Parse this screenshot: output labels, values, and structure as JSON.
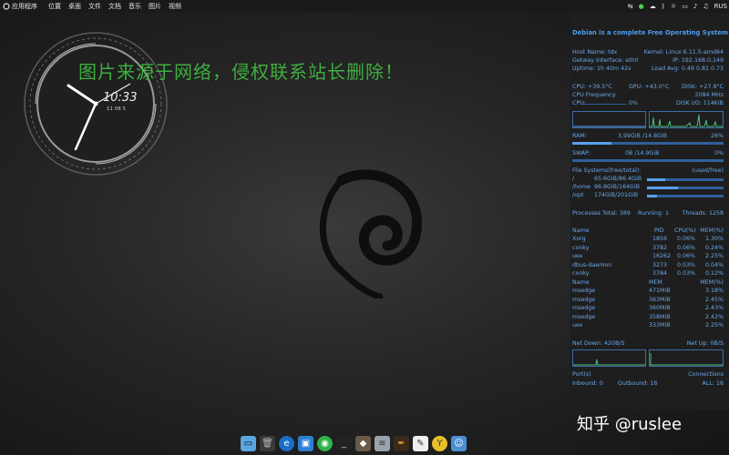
{
  "topbar": {
    "launcher": "应用程序",
    "menu": [
      "位置",
      "桌面",
      "文件",
      "文档",
      "音乐",
      "图片",
      "视频"
    ],
    "keyboard": "RUS"
  },
  "watermark": "图片来源于网络，侵权联系站长删除！",
  "clock": {
    "time": "10:33",
    "date": "11 08 5"
  },
  "conky": {
    "title": "Debian is a complete Free Operating System",
    "host_label": "Host Name:",
    "host": "tdx",
    "kernel_label": "Kernel:",
    "kernel": "Linux 6.11.5-amd64",
    "gateway_label": "Getway Interface:",
    "gateway": "eth0",
    "ip_label": "IP:",
    "ip": "192.168.0.149",
    "uptime_label": "Uptime:",
    "uptime": "1h 40m 42s",
    "load_label": "Load Avg:",
    "load": "0.49 0.81 0.73",
    "cpu_temp_label": "CPU:",
    "cpu_temp": "+39.5°C",
    "gpu_temp_label": "GPU:",
    "gpu_temp": "+43.0°C",
    "disk_temp_label": "DISK:",
    "disk_temp": "+27.9°C",
    "cpu_freq_label": "CPU Frequency:",
    "cpu_freq": "2084 MHz",
    "cpu_label": "CPU:",
    "cpu_pct": "0%",
    "disk_io_label": "DISK I/O:",
    "disk_io": "114KiB",
    "ram_label": "RAM:",
    "ram": "3.99GiB /14.8GiB",
    "ram_pct": "26%",
    "ram_fill": 0.26,
    "swap_label": "SWAP:",
    "swap": "0B /14.9GiB",
    "swap_pct": "0%",
    "swap_fill": 0.0,
    "fs_label": "File Systems(free/total):",
    "fs_used_label": "(used/free)",
    "filesystems": [
      {
        "mount": "/",
        "value": "65.6GiB/86.4GiB",
        "fill": 0.24
      },
      {
        "mount": "/home",
        "value": "96.8GiB/164GiB",
        "fill": 0.41
      },
      {
        "mount": "/opt",
        "value": "174GiB/201GiB",
        "fill": 0.13
      }
    ],
    "proc_total_label": "Processes Total:",
    "proc_total": "389",
    "running_label": "Running:",
    "running": "1",
    "threads_label": "Threads:",
    "threads": "1258",
    "cpu_table_headers": [
      "Name",
      "PID",
      "CPU(%)",
      "MEM(%)"
    ],
    "cpu_table": [
      [
        "Xorg",
        "1856",
        "0.06%",
        "1.30%"
      ],
      [
        "conky",
        "3782",
        "0.06%",
        "0.24%"
      ],
      [
        "uex",
        "16262",
        "0.06%",
        "2.25%"
      ],
      [
        "dbus-daemon",
        "3273",
        "0.03%",
        "0.04%"
      ],
      [
        "conky",
        "3784",
        "0.03%",
        "0.12%"
      ]
    ],
    "mem_table_headers": [
      "Name",
      "MEM",
      "MEM(%)"
    ],
    "mem_table": [
      [
        "msedge",
        "471MiB",
        "3.18%"
      ],
      [
        "msedge",
        "363MiB",
        "2.45%"
      ],
      [
        "msedge",
        "360MiB",
        "2.43%"
      ],
      [
        "msedge",
        "358MiB",
        "2.42%"
      ],
      [
        "uex",
        "333MiB",
        "2.25%"
      ]
    ],
    "net_down_label": "Net Down:",
    "net_down": "420B/S",
    "net_up_label": "Net Up:",
    "net_up": "0B/S",
    "port_label": "Port(s)",
    "connections_label": "Connections",
    "inbound_label": "Inbound:",
    "inbound": "0",
    "outbound_label": "Outbound:",
    "outbound": "16",
    "all_label": "ALL:",
    "all": "16"
  },
  "zhihu": "知乎 @ruslee",
  "dock": {
    "icons": [
      "file-manager-icon",
      "trash-icon",
      "edge-browser-icon",
      "image-viewer-icon",
      "wechat-icon",
      "terminal-icon",
      "gimp-icon",
      "database-icon",
      "feather-icon",
      "text-editor-icon",
      "yozo-office-icon",
      "finder-icon"
    ]
  },
  "colors": {
    "accent": "#4d9cf0",
    "watermark": "#3fae3f",
    "panel": "#1e1e1e"
  }
}
